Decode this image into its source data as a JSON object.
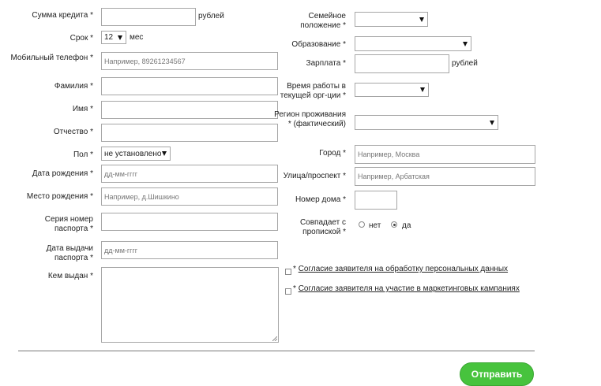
{
  "left": {
    "amount_label": "Сумма кредита *",
    "amount_unit": "рублей",
    "term_label": "Срок *",
    "term_value": "12",
    "term_unit": "мес",
    "mobile_label": "Мобильный телефон *",
    "mobile_placeholder": "Например, 89261234567",
    "surname_label": "Фамилия *",
    "name_label": "Имя *",
    "patronymic_label": "Отчество *",
    "gender_label": "Пол *",
    "gender_value": "не установлено",
    "birthdate_label": "Дата рождения *",
    "birthdate_placeholder": "дд-мм-гггг",
    "birthplace_label": "Место рождения *",
    "birthplace_placeholder": "Например, д.Шишкино",
    "passport_series_label": "Серия номер паспорта *",
    "passport_date_label": "Дата выдачи паспорта *",
    "passport_date_placeholder": "дд-мм-гггг",
    "issued_by_label": "Кем выдан *"
  },
  "right": {
    "marital_label": "Семейное положение *",
    "education_label": "Образование *",
    "salary_label": "Зарплата *",
    "salary_unit": "рублей",
    "work_time_label": "Время работы в текущей орг-ции *",
    "region_label": "Регион проживания * (фактический)",
    "city_label": "Город *",
    "city_placeholder": "Например, Москва",
    "street_label": "Улица/проспект *",
    "street_placeholder": "Например, Арбатская",
    "house_label": "Номер дома *",
    "registration_label": "Совпадает с пропиской *",
    "registration_no": "нет",
    "registration_yes": "да"
  },
  "agreements": {
    "star": "*",
    "personal_data": "Согласие заявителя на обработку персональных данных",
    "marketing": "Согласие заявителя на участие в маркетинговых кампаниях"
  },
  "submit_label": "Отправить",
  "colors": {
    "submit_bg": "#47c33d",
    "border": "#a6a6a6"
  }
}
